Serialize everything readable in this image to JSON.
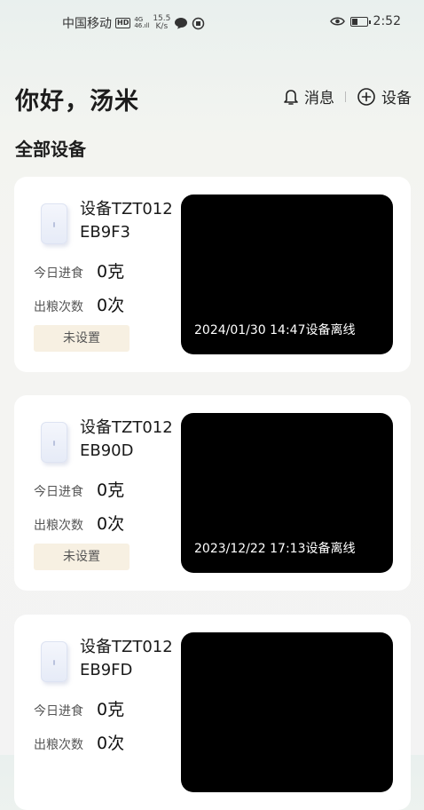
{
  "status_bar": {
    "carrier": "中国移动",
    "hd_badge": "HD",
    "network_top": "4G",
    "network_bottom": "46.ıll",
    "speed_value": "15.5",
    "speed_unit": "K/s",
    "time": "2:52"
  },
  "header": {
    "greeting": "你好，汤米",
    "messages_label": "消息",
    "add_device_label": "设备"
  },
  "section_title": "全部设备",
  "labels": {
    "food_today": "今日进食",
    "feed_count": "出粮次数"
  },
  "devices": [
    {
      "name": "设备TZT012EB9F3",
      "food_today": "0克",
      "feed_count": "0次",
      "tag": "未设置",
      "status": "2024/01/30 14:47设备离线"
    },
    {
      "name": "设备TZT012EB90D",
      "food_today": "0克",
      "feed_count": "0次",
      "tag": "未设置",
      "status": "2023/12/22 17:13设备离线"
    },
    {
      "name": "设备TZT012EB9FD",
      "food_today": "0克",
      "feed_count": "0次",
      "tag": "",
      "status": ""
    }
  ]
}
